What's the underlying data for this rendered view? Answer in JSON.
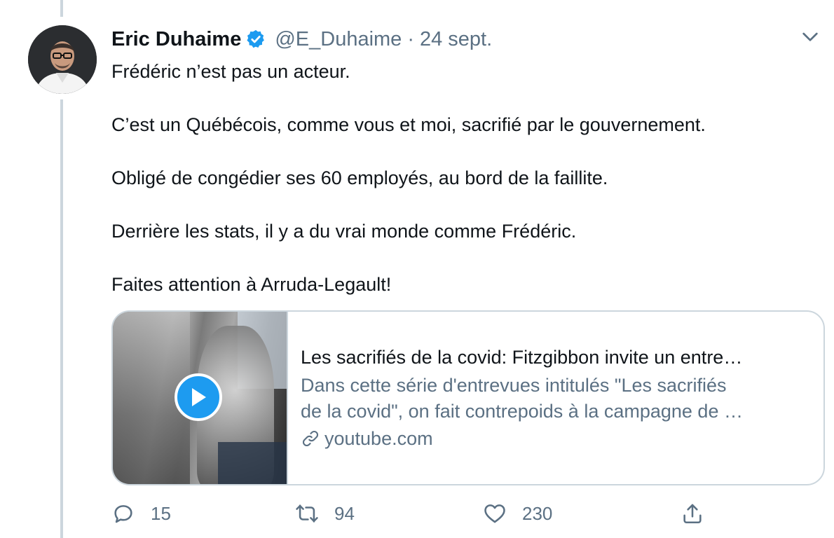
{
  "tweet": {
    "author_name": "Eric Duhaime",
    "handle": "@E_Duhaime",
    "separator": "·",
    "date": "24 sept.",
    "paragraphs": [
      "Frédéric n’est pas un acteur.",
      "C’est un Québécois, comme vous et moi, sacrifié par le gouvernement.",
      "Obligé de congédier ses 60 employés, au bord de la faillite.",
      "Derrière les stats, il y a du vrai monde comme Frédéric.",
      "Faites attention à Arruda-Legault!"
    ]
  },
  "card": {
    "title": "Les sacrifiés de la covid: Fitzgibbon invite un entre…",
    "description_line1": "Dans cette série d'entrevues intitulés \"Les sacrifiés",
    "description_line2": "de la covid\", on fait contrepoids à la campagne de …",
    "domain": "youtube.com"
  },
  "actions": {
    "reply_count": "15",
    "retweet_count": "94",
    "like_count": "230"
  },
  "colors": {
    "text": "#0f1419",
    "secondary": "#5b7083",
    "accent": "#1d9bf0",
    "border": "#ccd6dd"
  },
  "icons": [
    "verified-badge-icon",
    "chevron-down-icon",
    "play-icon",
    "link-icon",
    "reply-icon",
    "retweet-icon",
    "like-icon",
    "share-icon"
  ]
}
